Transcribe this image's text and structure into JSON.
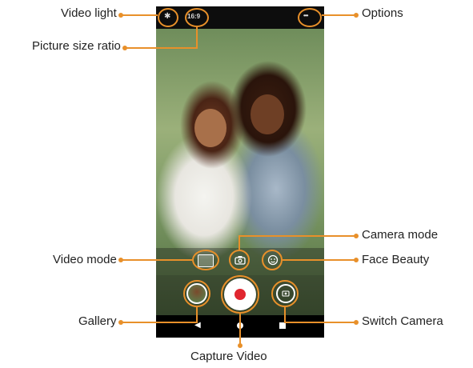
{
  "callouts": {
    "video_light": "Video light",
    "picture_size_ratio": "Picture size ratio",
    "options": "Options",
    "camera_mode": "Camera mode",
    "video_mode": "Video mode",
    "face_beauty": "Face Beauty",
    "gallery": "Gallery",
    "switch_camera": "Switch Camera",
    "capture_video": "Capture Video"
  },
  "status_bar": {
    "size_ratio_label": "16:9",
    "options_glyph": "•••",
    "light_glyph": "✱"
  },
  "icons": {
    "camera_mode": "camera-icon",
    "video_mode": "video-icon",
    "face_beauty": "face-beauty-icon",
    "gallery": "gallery-thumbnail",
    "switch_camera": "switch-camera-icon",
    "capture": "record-icon",
    "nav_back": "back-icon",
    "nav_home": "home-icon",
    "nav_recents": "recents-icon"
  },
  "colors": {
    "accent": "#e8902a",
    "record": "#e0262f"
  }
}
